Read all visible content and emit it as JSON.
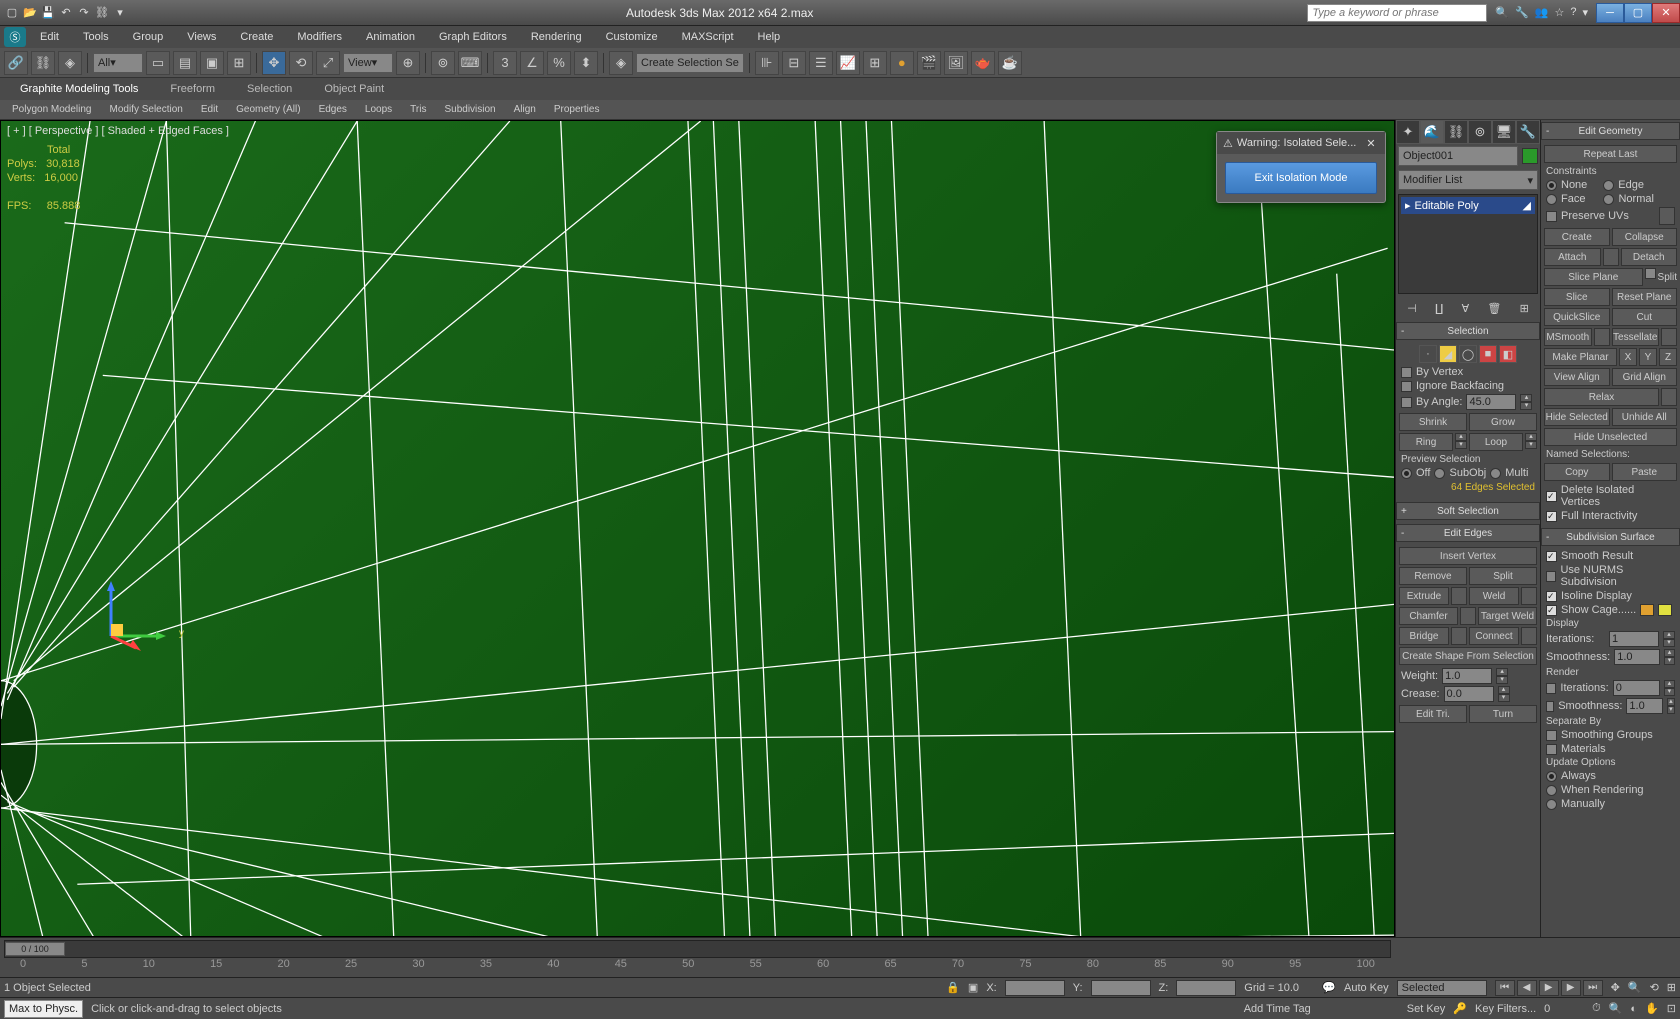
{
  "title": "Autodesk 3ds Max 2012 x64    2.max",
  "search_placeholder": "Type a keyword or phrase",
  "menus": [
    "Edit",
    "Tools",
    "Group",
    "Views",
    "Create",
    "Modifiers",
    "Animation",
    "Graph Editors",
    "Rendering",
    "Customize",
    "MAXScript",
    "Help"
  ],
  "toolbar": {
    "all": "All",
    "view": "View",
    "create_sel": "Create Selection Se"
  },
  "ribbon_tabs": [
    "Graphite Modeling Tools",
    "Freeform",
    "Selection",
    "Object Paint"
  ],
  "ribbon_items": [
    "Polygon Modeling",
    "Modify Selection",
    "Edit",
    "Geometry (All)",
    "Edges",
    "Loops",
    "Tris",
    "Subdivision",
    "Align",
    "Properties"
  ],
  "viewport": {
    "label": "[ + ] [ Perspective ] [ Shaded + Edged Faces ]",
    "stats_total": "Total",
    "stats_polys": "Polys:",
    "stats_polys_v": "30,818",
    "stats_verts": "Verts:",
    "stats_verts_v": "16,000",
    "stats_fps": "FPS:",
    "stats_fps_v": "85.888",
    "gizmo_y": "y"
  },
  "warn": {
    "title": "Warning: Isolated Sele...",
    "btn": "Exit Isolation Mode"
  },
  "cmd": {
    "object": "Object001",
    "modlist": "Modifier List",
    "stack_item": "Editable Poly"
  },
  "selection": {
    "title": "Selection",
    "by_vertex": "By Vertex",
    "ignore_bf": "Ignore Backfacing",
    "by_angle": "By Angle:",
    "angle_val": "45.0",
    "shrink": "Shrink",
    "grow": "Grow",
    "ring": "Ring",
    "loop": "Loop",
    "preview": "Preview Selection",
    "off": "Off",
    "subobj": "SubObj",
    "multi": "Multi",
    "status": "64 Edges Selected"
  },
  "softsel": {
    "title": "Soft Selection"
  },
  "edges": {
    "title": "Edit Edges",
    "insert_vertex": "Insert Vertex",
    "remove": "Remove",
    "split": "Split",
    "extrude": "Extrude",
    "weld": "Weld",
    "chamfer": "Chamfer",
    "target_weld": "Target Weld",
    "bridge": "Bridge",
    "connect": "Connect",
    "create_shape": "Create Shape From Selection",
    "weight": "Weight:",
    "weight_v": "1.0",
    "crease": "Crease:",
    "crease_v": "0.0",
    "edit_tri": "Edit Tri.",
    "turn": "Turn"
  },
  "geom": {
    "title": "Edit Geometry",
    "repeat": "Repeat Last",
    "constraints": "Constraints",
    "none": "None",
    "edge": "Edge",
    "face": "Face",
    "normal": "Normal",
    "preserve_uvs": "Preserve UVs",
    "create": "Create",
    "collapse": "Collapse",
    "attach": "Attach",
    "detach": "Detach",
    "slice_plane": "Slice Plane",
    "split": "Split",
    "slice": "Slice",
    "reset_plane": "Reset Plane",
    "quickslice": "QuickSlice",
    "cut": "Cut",
    "msmooth": "MSmooth",
    "tessellate": "Tessellate",
    "make_planar": "Make Planar",
    "x": "X",
    "y": "Y",
    "z": "Z",
    "view_align": "View Align",
    "grid_align": "Grid Align",
    "relax": "Relax",
    "hide_sel": "Hide Selected",
    "unhide_all": "Unhide All",
    "hide_unsel": "Hide Unselected",
    "named_sel": "Named Selections:",
    "copy": "Copy",
    "paste": "Paste",
    "del_iso": "Delete Isolated Vertices",
    "full_int": "Full Interactivity"
  },
  "subdiv": {
    "title": "Subdivision Surface",
    "smooth_result": "Smooth Result",
    "use_nurms": "Use NURMS Subdivision",
    "isoline": "Isoline Display",
    "show_cage": "Show Cage......",
    "display": "Display",
    "iterations": "Iterations:",
    "iter_v": "1",
    "smoothness": "Smoothness:",
    "smooth_v": "1.0",
    "render": "Render",
    "r_iter_v": "0",
    "r_smooth_v": "1.0",
    "separate": "Separate By",
    "smooth_groups": "Smoothing Groups",
    "materials": "Materials",
    "update": "Update Options",
    "always": "Always",
    "when_render": "When Rendering",
    "manually": "Manually"
  },
  "timeline": {
    "pos": "0 / 100",
    "ticks": [
      "0",
      "5",
      "10",
      "15",
      "20",
      "25",
      "30",
      "35",
      "40",
      "45",
      "50",
      "55",
      "60",
      "65",
      "70",
      "75",
      "80",
      "85",
      "90",
      "95",
      "100"
    ]
  },
  "status": {
    "obj_sel": "1 Object Selected",
    "grid": "Grid = 10.0",
    "x": "X:",
    "y": "Y:",
    "z": "Z:",
    "auto_key": "Auto Key",
    "selected": "Selected",
    "set_key": "Set Key",
    "key_filters": "Key Filters...",
    "add_time": "Add Time Tag"
  },
  "bottom": {
    "max": "Max to Physc.",
    "hint": "Click or click-and-drag to select objects"
  }
}
